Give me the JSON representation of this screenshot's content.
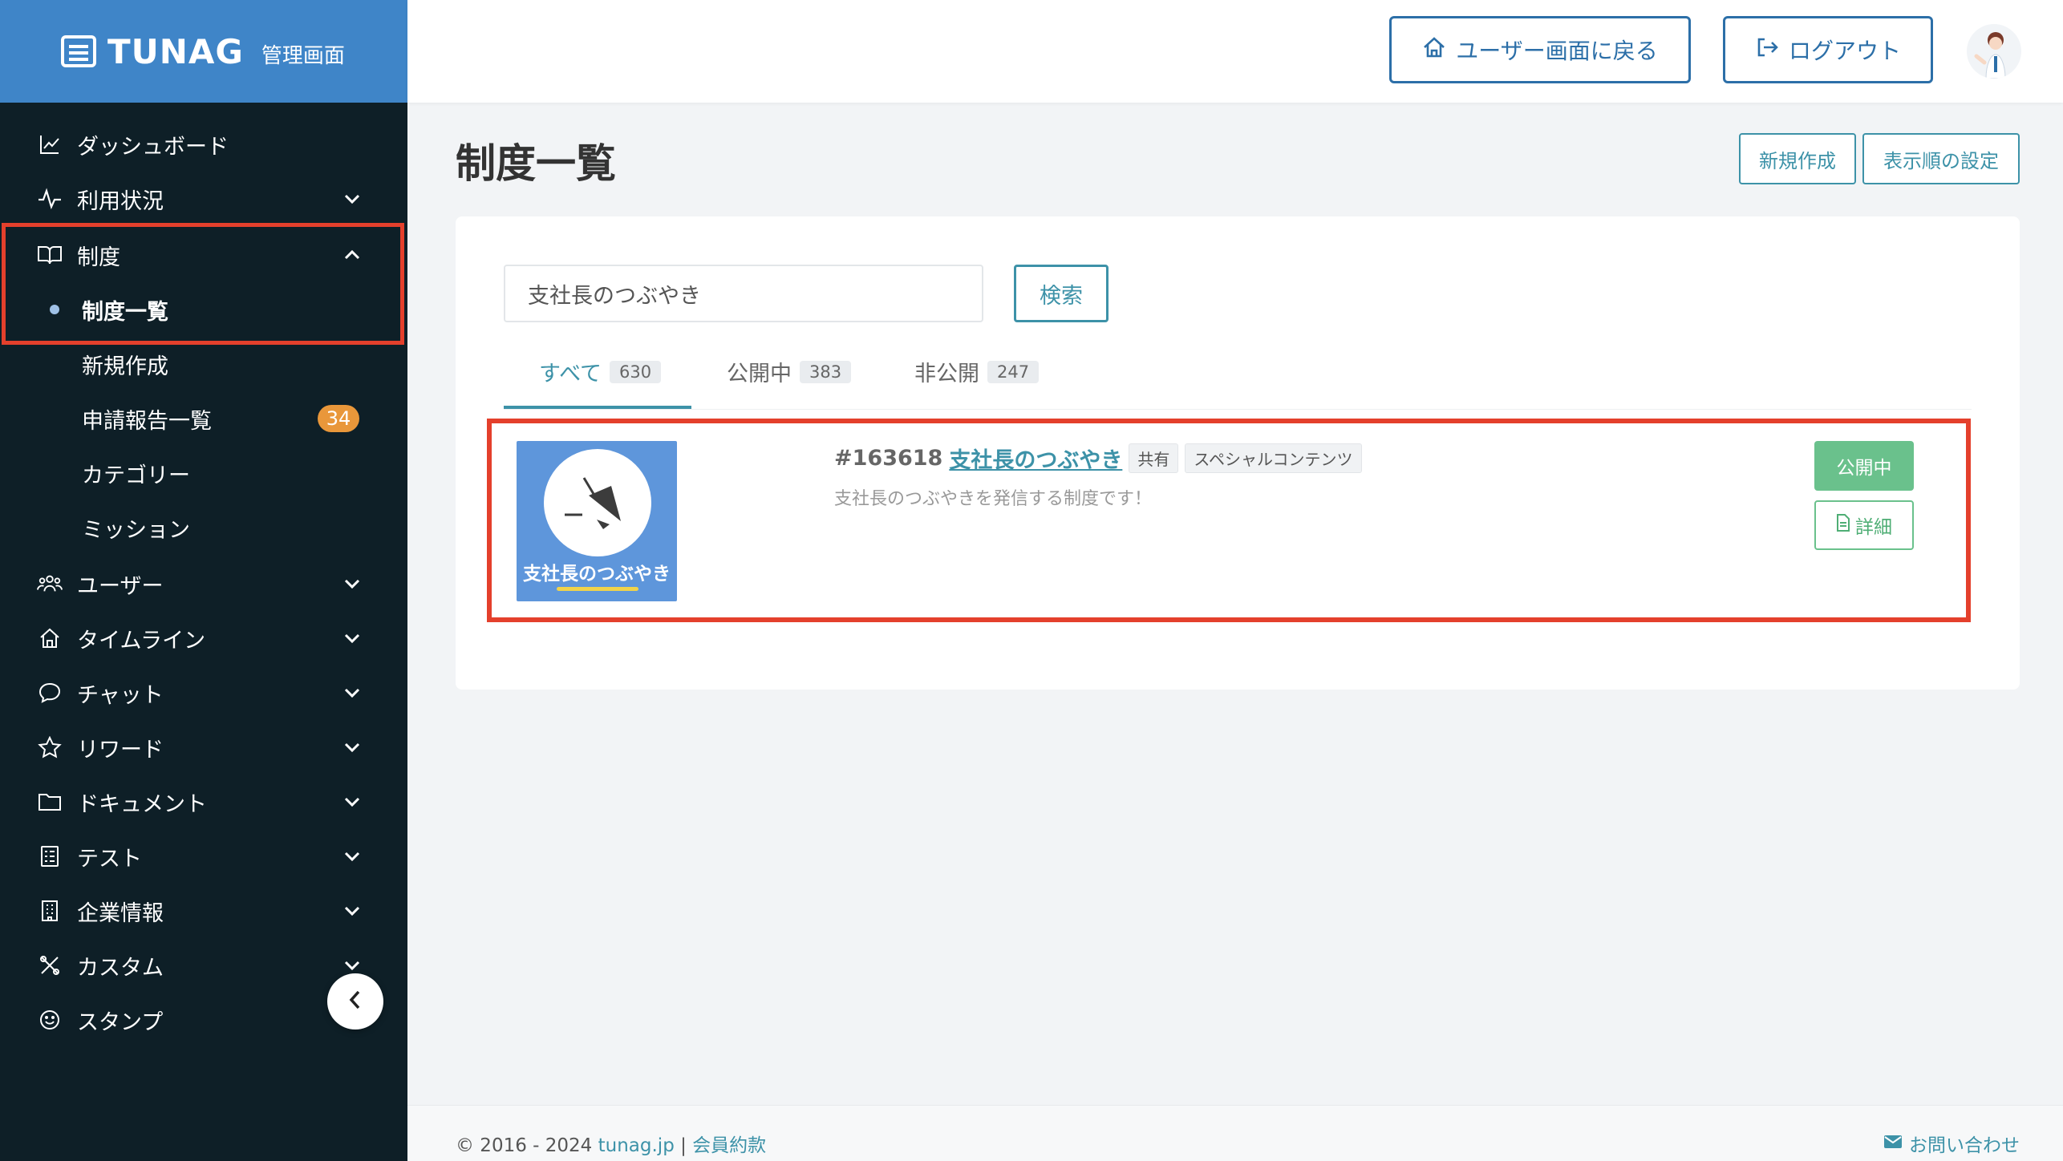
{
  "brand": {
    "name": "TUNAG",
    "subtitle": "管理画面"
  },
  "header": {
    "back_label": "ユーザー画面に戻る",
    "logout_label": "ログアウト"
  },
  "sidebar": {
    "items": [
      {
        "label": "ダッシュボード",
        "icon": "chart-line-icon"
      },
      {
        "label": "利用状況",
        "icon": "activity-icon"
      },
      {
        "label": "制度",
        "icon": "book-open-icon"
      },
      {
        "label": "制度一覧"
      },
      {
        "label": "新規作成"
      },
      {
        "label": "申請報告一覧",
        "badge": "34"
      },
      {
        "label": "カテゴリー"
      },
      {
        "label": "ミッション"
      },
      {
        "label": "ユーザー",
        "icon": "users-icon"
      },
      {
        "label": "タイムライン",
        "icon": "home-icon"
      },
      {
        "label": "チャット",
        "icon": "chat-bubble-icon"
      },
      {
        "label": "リワード",
        "icon": "star-icon"
      },
      {
        "label": "ドキュメント",
        "icon": "folder-icon"
      },
      {
        "label": "テスト",
        "icon": "checklist-icon"
      },
      {
        "label": "企業情報",
        "icon": "building-icon"
      },
      {
        "label": "カスタム",
        "icon": "tools-icon"
      },
      {
        "label": "スタンプ",
        "icon": "smile-icon"
      }
    ]
  },
  "main": {
    "title": "制度一覧",
    "new_label": "新規作成",
    "order_label": "表示順の設定",
    "search": {
      "value": "支社長のつぶやき",
      "button": "検索"
    },
    "tabs": [
      {
        "label": "すべて",
        "count": "630"
      },
      {
        "label": "公開中",
        "count": "383"
      },
      {
        "label": "非公開",
        "count": "247"
      }
    ],
    "item": {
      "id": "#163618",
      "name": "支社長のつぶやき",
      "tags": [
        "共有",
        "スペシャルコンテンツ"
      ],
      "description": "支社長のつぶやきを発信する制度です！",
      "thumb_text": "支社長のつぶやき",
      "status": "公開中",
      "detail": "詳細"
    }
  },
  "footer": {
    "copyright": "© 2016 - 2024",
    "site": "tunag.jp",
    "separator": "|",
    "terms": "会員約款",
    "contact": "お問い合わせ"
  },
  "colors": {
    "brand": "#3f85c8",
    "sidebar": "#0e1f27",
    "accent": "#3d92a8",
    "status": "#6ac18c",
    "highlight": "#e4402c",
    "badge": "#e9973a"
  }
}
